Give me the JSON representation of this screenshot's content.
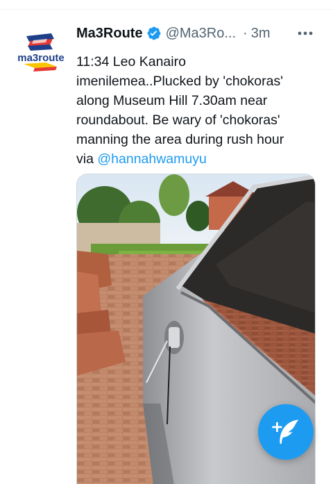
{
  "tweet": {
    "author_name": "Ma3Route",
    "handle": "@Ma3Ro...",
    "separator": "·",
    "time": "3m",
    "avatar_text": "ma3route",
    "body_lines": [
      "11:34 Leo Kanairo",
      "imenilemea..Plucked by 'chokoras'",
      "along Museum Hill 7.30am near",
      "roundabout.  Be wary of 'chokoras'",
      "manning the area during rush hour"
    ],
    "via_text": "via ",
    "mention": "@hannahwamuyu"
  },
  "icons": {
    "verified": "verified-badge-icon",
    "more": "more-dots-icon",
    "compose": "compose-feather-icon"
  },
  "colors": {
    "accent": "#1d9bf0",
    "text": "#0f1419",
    "muted": "#536471"
  }
}
